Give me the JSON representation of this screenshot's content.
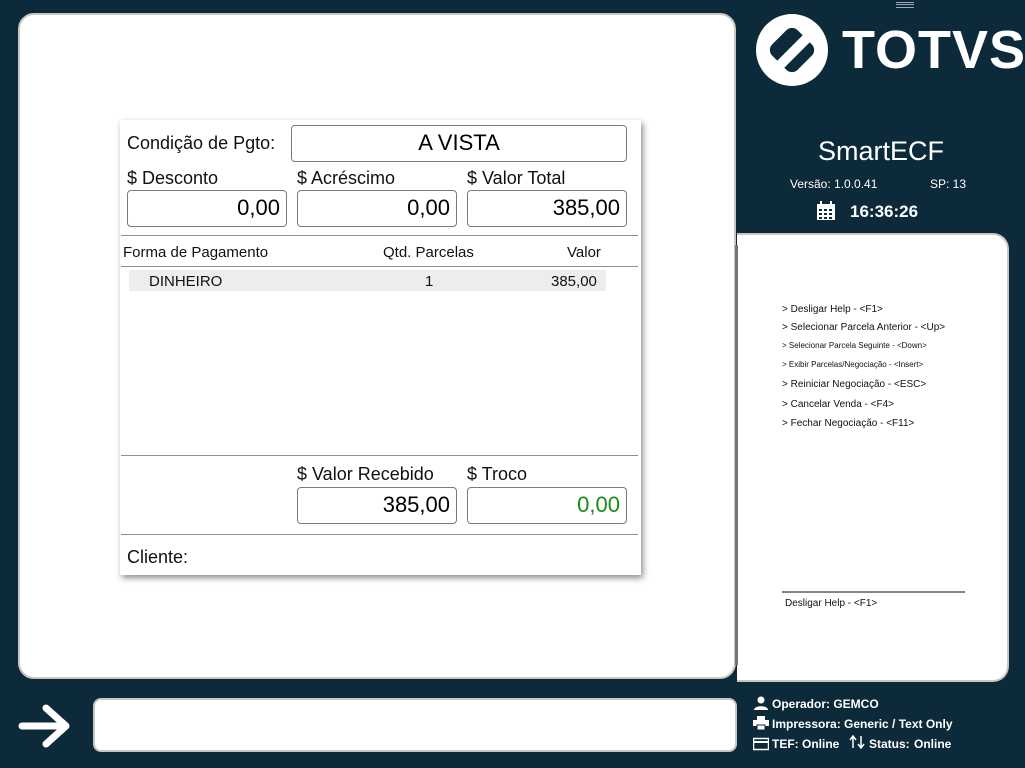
{
  "brand": {
    "logo_text": "TOTVS",
    "app_name": "SmartECF",
    "version": "Versão: 1.0.0.41",
    "sp": "SP: 13",
    "time": "16:36:26"
  },
  "form": {
    "condicao_label": "Condição de Pgto:",
    "condicao_value": "A VISTA",
    "desconto_label": "$ Desconto",
    "desconto_value": "0,00",
    "acrescimo_label": "$ Acréscimo",
    "acrescimo_value": "0,00",
    "valor_total_label": "$ Valor Total",
    "valor_total_value": "385,00",
    "table": {
      "headers": [
        "Forma de Pagamento",
        "Qtd. Parcelas",
        "Valor"
      ],
      "rows": [
        {
          "forma": "DINHEIRO",
          "parcelas": "1",
          "valor": "385,00"
        }
      ]
    },
    "valor_recebido_label": "$ Valor Recebido",
    "valor_recebido_value": "385,00",
    "troco_label": "$ Troco",
    "troco_value": "0,00",
    "cliente_label": "Cliente:"
  },
  "help": {
    "items": [
      "> Desligar Help - <F1>",
      "> Selecionar Parcela Anterior - <Up>",
      "> Selecionar Parcela Seguinte - <Down>",
      "> Exibir Parcelas/Negociação - <Insert>",
      "> Reiniciar Negociação - <ESC>",
      "> Cancelar Venda - <F4>",
      "> Fechar Negociação - <F11>"
    ],
    "footer": "Desligar Help - <F1>"
  },
  "status": {
    "operador": "Operador: GEMCO",
    "impressora": "Impressora: Generic / Text Only",
    "tef": "TEF: Online",
    "status_label": "Status:",
    "status_value": "Online"
  },
  "colors": {
    "background": "#0d2a3a",
    "troco": "#1a8a1a"
  },
  "icons": [
    "calendar-icon",
    "arrow-right-icon",
    "user-icon",
    "printer-icon",
    "card-icon",
    "transfer-icon"
  ]
}
